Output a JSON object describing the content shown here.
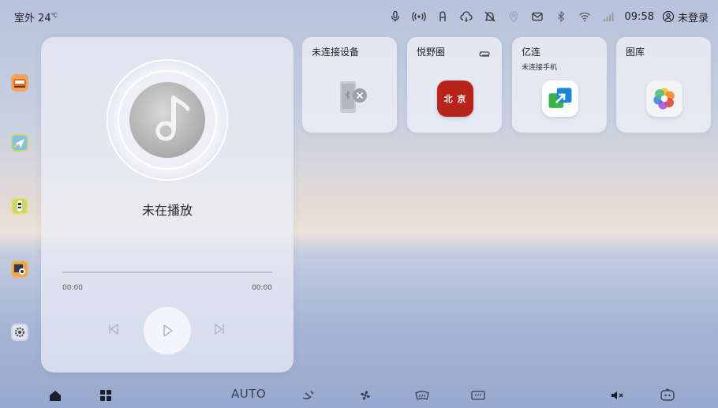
{
  "status": {
    "temperature": "室外 24",
    "temp_unit": "℃",
    "time": "09:58",
    "login": "未登录",
    "icons": [
      "mic-icon",
      "hotspot-icon",
      "seat-icon",
      "cloud-icon",
      "notification-off-icon",
      "location-icon",
      "mail-icon",
      "bluetooth-icon",
      "wifi-icon",
      "signal-icon",
      "user-icon"
    ]
  },
  "sidebar": {
    "items": [
      "car-seat",
      "navigation",
      "car-top-view",
      "camera-360",
      "settings"
    ]
  },
  "player": {
    "status": "未在播放",
    "time_start": "00:00",
    "time_end": "00:00",
    "controls": [
      "previous-icon",
      "play-icon",
      "next-icon"
    ]
  },
  "cards": [
    {
      "title": "未连接设备",
      "subtitle": "",
      "icon": "phone-disconnected-icon"
    },
    {
      "title": "悦野圈",
      "subtitle": "",
      "icon": "beijing-app-icon",
      "app_text": "北 京"
    },
    {
      "title": "亿连",
      "subtitle": "未连接手机",
      "icon": "easyconnect-icon"
    },
    {
      "title": "图库",
      "subtitle": "",
      "icon": "gallery-icon"
    }
  ],
  "bottom": {
    "auto_label": "AUTO",
    "icons": [
      "home-icon",
      "apps-icon",
      "fan-direction-icon",
      "fan-icon",
      "front-defrost-icon",
      "rear-defrost-icon",
      "mute-icon",
      "assistant-icon"
    ]
  },
  "colors": {
    "accent_red": "#b8231b",
    "accent_blue": "#1d86d6",
    "accent_green": "#39b54a"
  }
}
